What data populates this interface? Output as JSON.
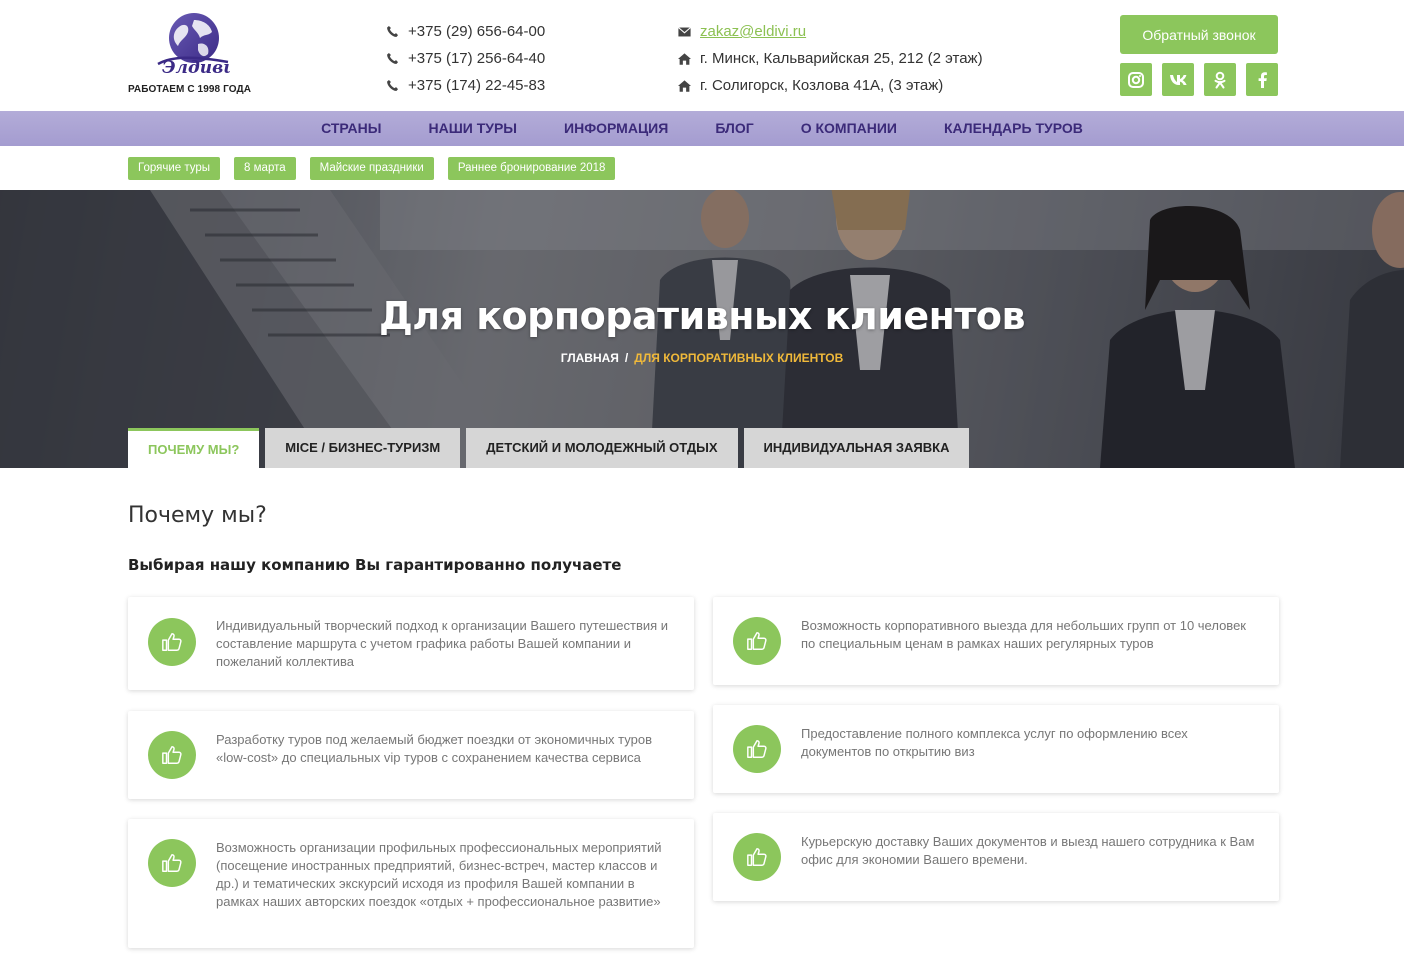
{
  "logo": {
    "name": "Элдиви",
    "tagline": "РАБОТАЕМ С 1998 ГОДА"
  },
  "phones": [
    "+375 (29) 656-64-00",
    "+375 (17) 256-64-40",
    "+375 (174) 22-45-83"
  ],
  "contacts": {
    "email": "zakaz@eldivi.ru",
    "address1": "г. Минск, Кальварийская 25, 212 (2 этаж)",
    "address2": "г. Солигорск, Козлова 41А, (3 этаж)"
  },
  "callback_label": "Обратный звонок",
  "socials": [
    "instagram-icon",
    "vk-icon",
    "odnoklassniki-icon",
    "facebook-icon"
  ],
  "nav": [
    "Страны",
    "Наши туры",
    "Информация",
    "Блог",
    "О компании",
    "Календарь туров"
  ],
  "tags": [
    "Горячие туры",
    "8 марта",
    "Майские праздники",
    "Раннее бронирование 2018"
  ],
  "hero": {
    "title": "Для корпоративных клиентов",
    "breadcrumb_home": "Главная",
    "breadcrumb_sep": "/",
    "breadcrumb_current": "Для корпоративных клиентов"
  },
  "tabs": [
    "Почему мы?",
    "MICE / бизнес-туризм",
    "Детский и молодежный отдых",
    "Индивидуальная заявка"
  ],
  "content": {
    "heading": "Почему мы?",
    "subheading": "Выбирая нашу компанию Вы гарантированно получаете",
    "cards": [
      "Индивидуальный творческий подход к организации Вашего путешествия и составление маршрута с учетом графика работы Вашей компании и пожеланий коллектива",
      "Возможность корпоративного выезда для небольших групп от 10 человек по специальным ценам в рамках наших регулярных туров",
      "Разработку туров под желаемый бюджет поездки от экономичных туров «low-cost» до специальных vip туров с сохранением качества сервиса",
      "Предоставление полного комплекса услуг по оформлению всех документов по открытию виз",
      "Возможность организации профильных профессиональных мероприятий (посещение иностранных предприятий, бизнес-встреч, мастер классов и др.) и тематических экскурсий исходя из профиля Вашей компании в рамках наших авторских поездок «отдых + профессиональное развитие»",
      "Курьерскую доставку Ваших документов и выезд нашего сотрудника к Вам офис для экономии Вашего времени."
    ]
  },
  "colors": {
    "accent": "#8cc65c",
    "nav_bg": "#aba4d4",
    "nav_text": "#3b2a79",
    "breadcrumb_active": "#f0b93a"
  }
}
